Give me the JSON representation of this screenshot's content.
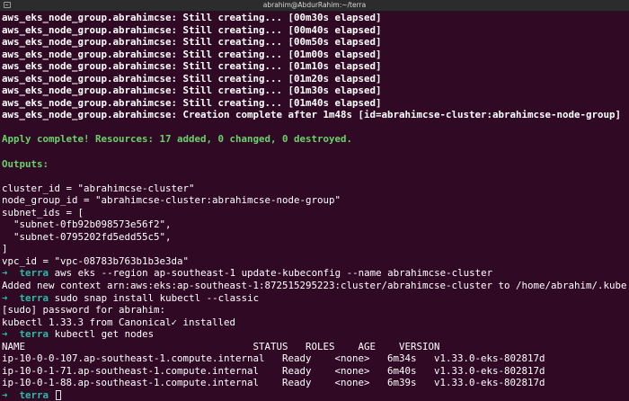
{
  "window": {
    "title": "abrahim@AbdurRahim:~/terra"
  },
  "terminal": {
    "creating_lines": [
      "aws_eks_node_group.abrahimcse: Still creating... [00m30s elapsed]",
      "aws_eks_node_group.abrahimcse: Still creating... [00m40s elapsed]",
      "aws_eks_node_group.abrahimcse: Still creating... [00m50s elapsed]",
      "aws_eks_node_group.abrahimcse: Still creating... [01m00s elapsed]",
      "aws_eks_node_group.abrahimcse: Still creating... [01m10s elapsed]",
      "aws_eks_node_group.abrahimcse: Still creating... [01m20s elapsed]",
      "aws_eks_node_group.abrahimcse: Still creating... [01m30s elapsed]",
      "aws_eks_node_group.abrahimcse: Still creating... [01m40s elapsed]",
      "aws_eks_node_group.abrahimcse: Creation complete after 1m48s [id=abrahimcse-cluster:abrahimcse-node-group]"
    ],
    "apply_complete": "Apply complete! Resources: 17 added, 0 changed, 0 destroyed.",
    "outputs_header": "Outputs:",
    "outputs": [
      "cluster_id = \"abrahimcse-cluster\"",
      "node_group_id = \"abrahimcse-cluster:abrahimcse-node-group\"",
      "subnet_ids = [",
      "  \"subnet-0fb92b098573e56f2\",",
      "  \"subnet-0795202fd5edd55c5\",",
      "]",
      "vpc_id = \"vpc-08783b763b1b3e3da\""
    ],
    "prompt_arrow": "➜",
    "prompt_dir": "terra",
    "cmd1": "aws eks --region ap-southeast-1 update-kubeconfig --name abrahimcse-cluster",
    "cmd1_output": "Added new context arn:aws:eks:ap-southeast-1:872515295223:cluster/abrahimcse-cluster to /home/abrahim/.kube/config",
    "cmd2": "sudo snap install kubectl --classic",
    "cmd2_output": [
      "[sudo] password for abrahim:",
      "kubectl 1.33.3 from Canonical✓ installed"
    ],
    "cmd3": "kubectl get nodes",
    "nodes_table": {
      "header": "NAME                                       STATUS   ROLES    AGE    VERSION",
      "rows": [
        "ip-10-0-0-107.ap-southeast-1.compute.internal   Ready    <none>   6m34s   v1.33.0-eks-802817d",
        "ip-10-0-1-71.ap-southeast-1.compute.internal    Ready    <none>   6m40s   v1.33.0-eks-802817d",
        "ip-10-0-1-88.ap-southeast-1.compute.internal    Ready    <none>   6m39s   v1.33.0-eks-802817d"
      ],
      "columns": [
        "NAME",
        "STATUS",
        "ROLES",
        "AGE",
        "VERSION"
      ]
    }
  },
  "colors": {
    "background": "#300a24",
    "prompt_accent": "#23bfa7",
    "success_green": "#6bd16b",
    "text": "#ffffff"
  }
}
